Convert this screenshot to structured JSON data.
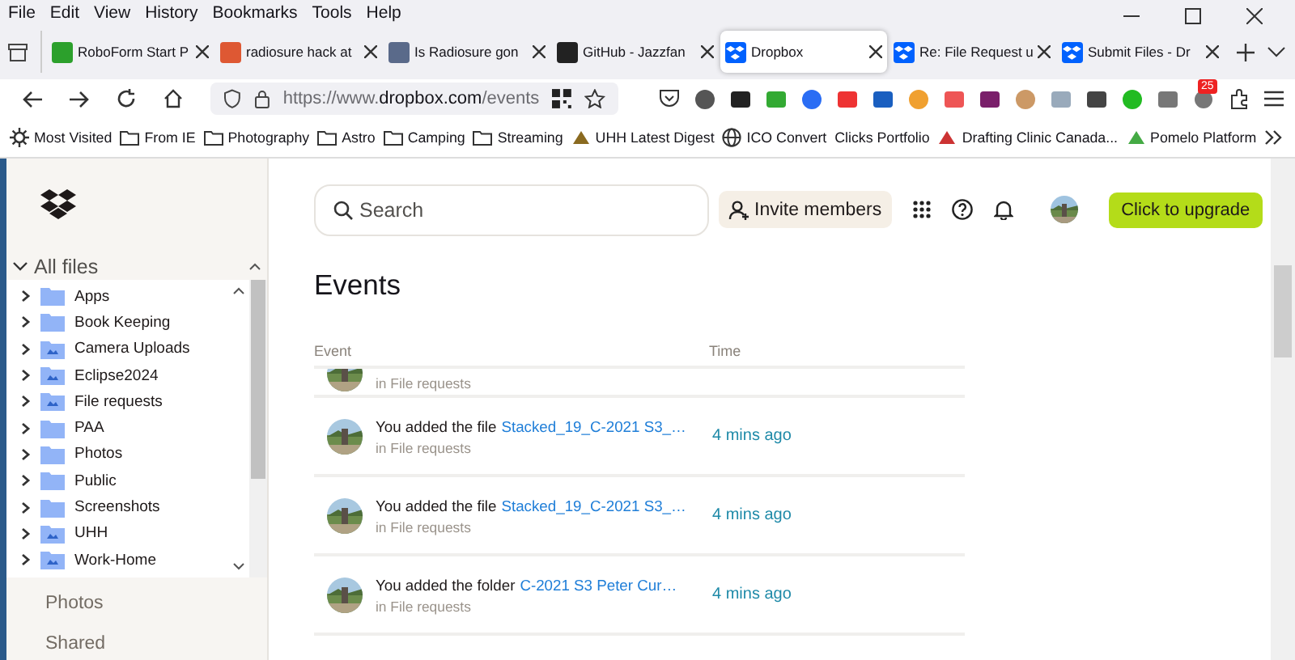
{
  "menu_bar": [
    "File",
    "Edit",
    "View",
    "History",
    "Bookmarks",
    "Tools",
    "Help"
  ],
  "tabs": [
    {
      "title": "RoboForm Start P",
      "selected": false
    },
    {
      "title": "radiosure hack at",
      "selected": false
    },
    {
      "title": "Is Radiosure gon",
      "selected": false
    },
    {
      "title": "GitHub - Jazzfan",
      "selected": false
    },
    {
      "title": "Dropbox",
      "selected": true
    },
    {
      "title": "Re: File Request u",
      "selected": false
    },
    {
      "title": "Submit Files - Dr",
      "selected": false
    }
  ],
  "address_bar": {
    "prefix": "https://www.",
    "domain": "dropbox.com",
    "path": "/events"
  },
  "extension_badge": "25",
  "bookmarks": [
    {
      "label": "Most Visited",
      "kind": "special"
    },
    {
      "label": "From IE",
      "kind": "folder"
    },
    {
      "label": "Photography",
      "kind": "folder"
    },
    {
      "label": "Astro",
      "kind": "folder"
    },
    {
      "label": "Camping",
      "kind": "folder"
    },
    {
      "label": "Streaming",
      "kind": "folder"
    },
    {
      "label": "UHH Latest Digest",
      "kind": "site"
    },
    {
      "label": "ICO Convert",
      "kind": "globe"
    },
    {
      "label": "Clicks Portfolio",
      "kind": "plain"
    },
    {
      "label": "Drafting Clinic Canada...",
      "kind": "site"
    },
    {
      "label": "Pomelo Platform",
      "kind": "site"
    }
  ],
  "sidebar": {
    "section": "All files",
    "expanded": true,
    "folders": [
      {
        "name": "Apps",
        "kind": "plain"
      },
      {
        "name": "Book Keeping",
        "kind": "plain"
      },
      {
        "name": "Camera Uploads",
        "kind": "shared"
      },
      {
        "name": "Eclipse2024",
        "kind": "shared"
      },
      {
        "name": "File requests",
        "kind": "shared"
      },
      {
        "name": "PAA",
        "kind": "plain"
      },
      {
        "name": "Photos",
        "kind": "plain"
      },
      {
        "name": "Public",
        "kind": "plain"
      },
      {
        "name": "Screenshots",
        "kind": "plain"
      },
      {
        "name": "UHH",
        "kind": "shared"
      },
      {
        "name": "Work-Home",
        "kind": "shared"
      }
    ],
    "nav": [
      "Photos",
      "Shared"
    ]
  },
  "search": {
    "placeholder": "Search"
  },
  "invite_button": "Invite members",
  "upgrade_button": "Click to upgrade",
  "page_title": "Events",
  "table": {
    "columns": [
      "Event",
      "Time"
    ],
    "rows": [
      {
        "location": "in File requests"
      },
      {
        "action": "You added the file",
        "link": "Stacked_19_C-2021 S3_…",
        "location": "in File requests",
        "time": "4 mins ago"
      },
      {
        "action": "You added the file",
        "link": "Stacked_19_C-2021 S3_…",
        "location": "in File requests",
        "time": "4 mins ago"
      },
      {
        "action": "You added the folder",
        "link": "C-2021 S3 Peter Cur…",
        "location": "in File requests",
        "time": "4 mins ago"
      }
    ]
  }
}
